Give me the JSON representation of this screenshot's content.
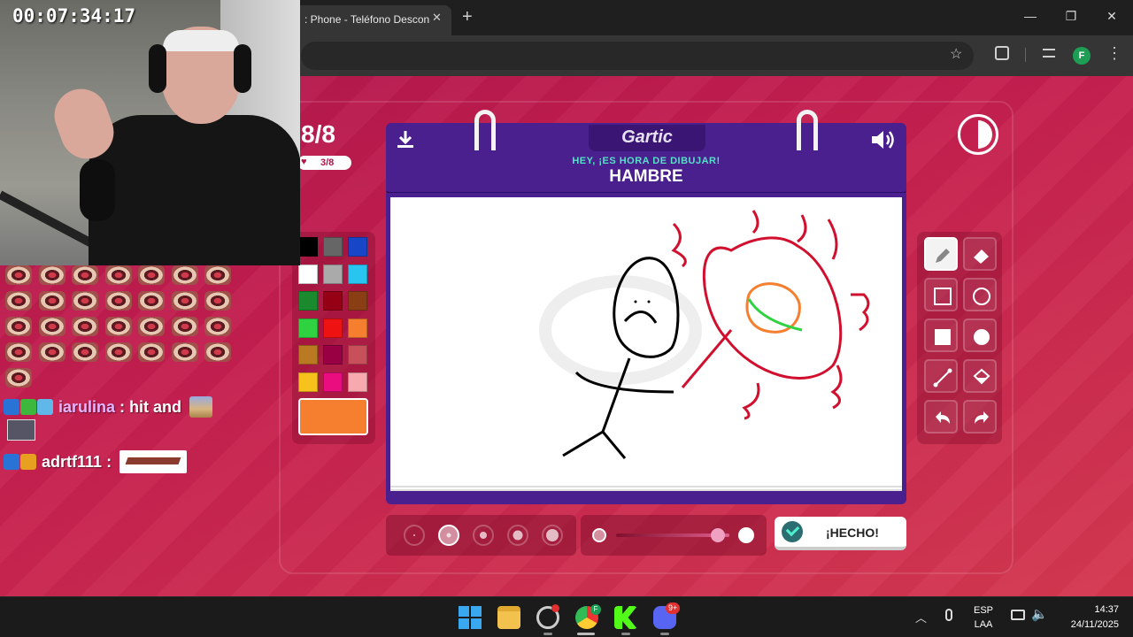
{
  "browser": {
    "tab_title": ": Phone - Teléfono Descon",
    "close_glyph": "✕",
    "new_tab_glyph": "+",
    "profile_letter": "F",
    "window_buttons": [
      "—",
      "❐",
      "✕"
    ]
  },
  "game": {
    "round": "8/8",
    "progress": "3/8",
    "logo": "Gartic",
    "prompt_label": "HEY, ¡ES HORA DE DIBUJAR!",
    "prompt_word": "HAMBRE",
    "done_label": "¡HECHO!",
    "current_color": "#f57f2e",
    "palette": [
      "#000000",
      "#666666",
      "#1746c6",
      "#ffffff",
      "#aaaaaa",
      "#29c4f0",
      "#1b8a2f",
      "#960014",
      "#8a3e14",
      "#2fd241",
      "#ef1212",
      "#f57f2e",
      "#b97a22",
      "#990044",
      "#c8505b",
      "#f8c21c",
      "#ea0d80",
      "#f6aab0"
    ],
    "tools": [
      "pencil-icon",
      "eraser-icon",
      "rectangle-outline-icon",
      "circle-outline-icon",
      "rectangle-filled-icon",
      "circle-filled-icon",
      "line-icon",
      "fill-bucket-icon",
      "undo-icon",
      "redo-icon"
    ],
    "brush_sizes": 5,
    "selected_brush": 2,
    "opacity_level": 0.9
  },
  "stream": {
    "timer": "00:07:34:17",
    "chat": [
      {
        "user": "iarulina",
        "message": " : hit and "
      },
      {
        "user": "adrtf111",
        "message": " : "
      }
    ]
  },
  "taskbar": {
    "language": "ESP",
    "layout": "LAA",
    "time": "14:37",
    "date": "24/11/2025",
    "discord_badge": "9+",
    "chrome_badge": "F"
  }
}
